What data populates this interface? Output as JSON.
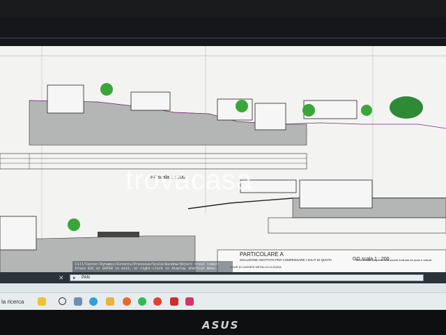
{
  "drawing": {
    "section_ff_label": "FF scala 1 : 200",
    "section_gg_label": "GG scala 1 : 200",
    "detail_title": "PARTICOLARE A",
    "detail_subtitle": "SOLUZIONE ADOTTATA PER COMPENSARE I SALTI DI QUOTA",
    "detail_note": "Terra armata ricoperta nella parete inclinata da prato e arbusti",
    "detail_note2": "ODAR DI CASSERI METALLICI A GUIDA"
  },
  "command_line": {
    "history_1": "Fill/Center/Dynamic/Extents/Previous/Scale/Window/Object <real time>:",
    "history_2": "Press ESC or ENTER to exit, or right-click to display shortcut menu.",
    "prompt_value": "PAN"
  },
  "taskbar": {
    "search_text": "la ricerca"
  },
  "watermark": {
    "text": "trovacasa"
  },
  "monitor": {
    "brand": "ASUS"
  }
}
